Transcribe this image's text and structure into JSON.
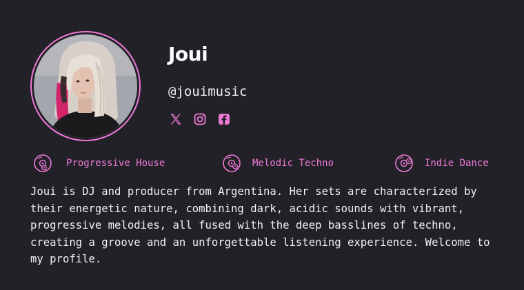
{
  "profile": {
    "name": "Joui",
    "handle": "@jouimusic",
    "socials": [
      {
        "icon": "x-icon"
      },
      {
        "icon": "instagram-icon"
      },
      {
        "icon": "facebook-icon"
      }
    ]
  },
  "genres": [
    {
      "label": "Progressive House",
      "icon": "vinyl-disc-icon"
    },
    {
      "label": "Melodic Techno",
      "icon": "vinyl-disc-icon"
    },
    {
      "label": "Indie Dance",
      "icon": "vinyl-disc-icon"
    }
  ],
  "bio": "Joui is DJ and producer from Argentina. Her sets are characterized by their energetic nature, combining dark, acidic sounds with vibrant, progressive melodies, all fused with the deep basslines of techno, creating a groove and an unforgettable listening experience. Welcome to my profile.",
  "colors": {
    "background": "#222127",
    "accent": "#f07ad8",
    "text": "#f2f2f4"
  }
}
